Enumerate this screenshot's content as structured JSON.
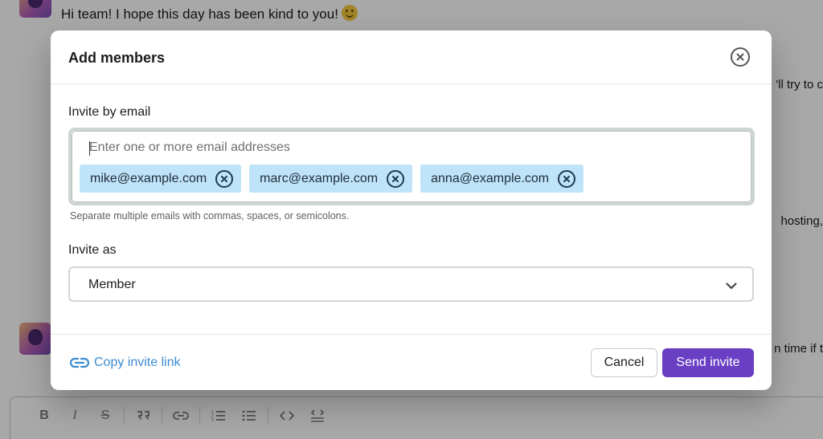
{
  "background": {
    "message_top": "Hi team! I hope this day has been kind to you!",
    "side_text_1": "'ll try to c",
    "side_text_2": "hosting,",
    "side_text_3": "n time if t"
  },
  "modal": {
    "title": "Add members",
    "invite_by_email_label": "Invite by email",
    "email_placeholder": "Enter one or more email addresses",
    "emails": [
      "mike@example.com",
      "marc@example.com",
      "anna@example.com"
    ],
    "hint": "Separate multiple emails with commas, spaces, or semicolons.",
    "invite_as_label": "Invite as",
    "invite_as_value": "Member",
    "copy_invite_link": "Copy invite link",
    "cancel_label": "Cancel",
    "send_label": "Send invite"
  },
  "colors": {
    "accent": "#6a3fc4",
    "link": "#3d8bd0",
    "chip": "#bfe3f8"
  },
  "toolbar_icons": [
    "bold-icon",
    "italic-icon",
    "strikethrough-icon",
    "quote-icon",
    "link-icon",
    "numbered-list-icon",
    "bulleted-list-icon",
    "code-icon",
    "code-block-icon"
  ]
}
